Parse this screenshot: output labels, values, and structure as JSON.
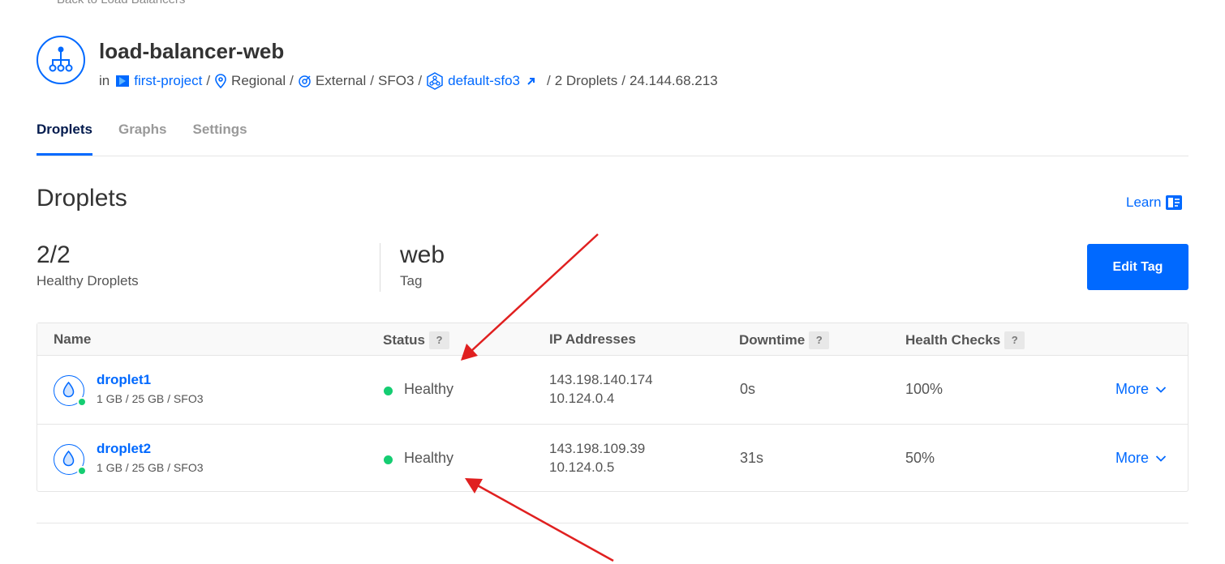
{
  "back_link": "Back to Load Balancers",
  "lb": {
    "icon": "load-balancer-icon",
    "name": "load-balancer-web",
    "meta": {
      "in_label": "in",
      "project": "first-project",
      "region_type": "Regional",
      "network": "External",
      "datacenter": "SFO3",
      "vpc": "default-sfo3",
      "droplet_count": "2 Droplets",
      "ip": "24.144.68.213"
    }
  },
  "tabs": [
    "Droplets",
    "Graphs",
    "Settings"
  ],
  "section": {
    "title": "Droplets",
    "learn_label": "Learn"
  },
  "stats": {
    "healthy_value": "2/2",
    "healthy_label": "Healthy Droplets",
    "tag_value": "web",
    "tag_label": "Tag"
  },
  "edit_tag_label": "Edit Tag",
  "table": {
    "headers": {
      "name": "Name",
      "status": "Status",
      "ip": "IP Addresses",
      "downtime": "Downtime",
      "health": "Health Checks",
      "help_mark": "?"
    },
    "rows": [
      {
        "name": "droplet1",
        "spec": "1 GB / 25 GB / SFO3",
        "status": "Healthy",
        "public_ip": "143.198.140.174",
        "private_ip": "10.124.0.4",
        "downtime": "0s",
        "health": "100%",
        "more_label": "More"
      },
      {
        "name": "droplet2",
        "spec": "1 GB / 25 GB / SFO3",
        "status": "Healthy",
        "public_ip": "143.198.109.39",
        "private_ip": "10.124.0.5",
        "downtime": "31s",
        "health": "50%",
        "more_label": "More"
      }
    ]
  },
  "colors": {
    "accent": "#0069ff",
    "healthy": "#15cd72",
    "annotation_arrow": "#e02020"
  }
}
